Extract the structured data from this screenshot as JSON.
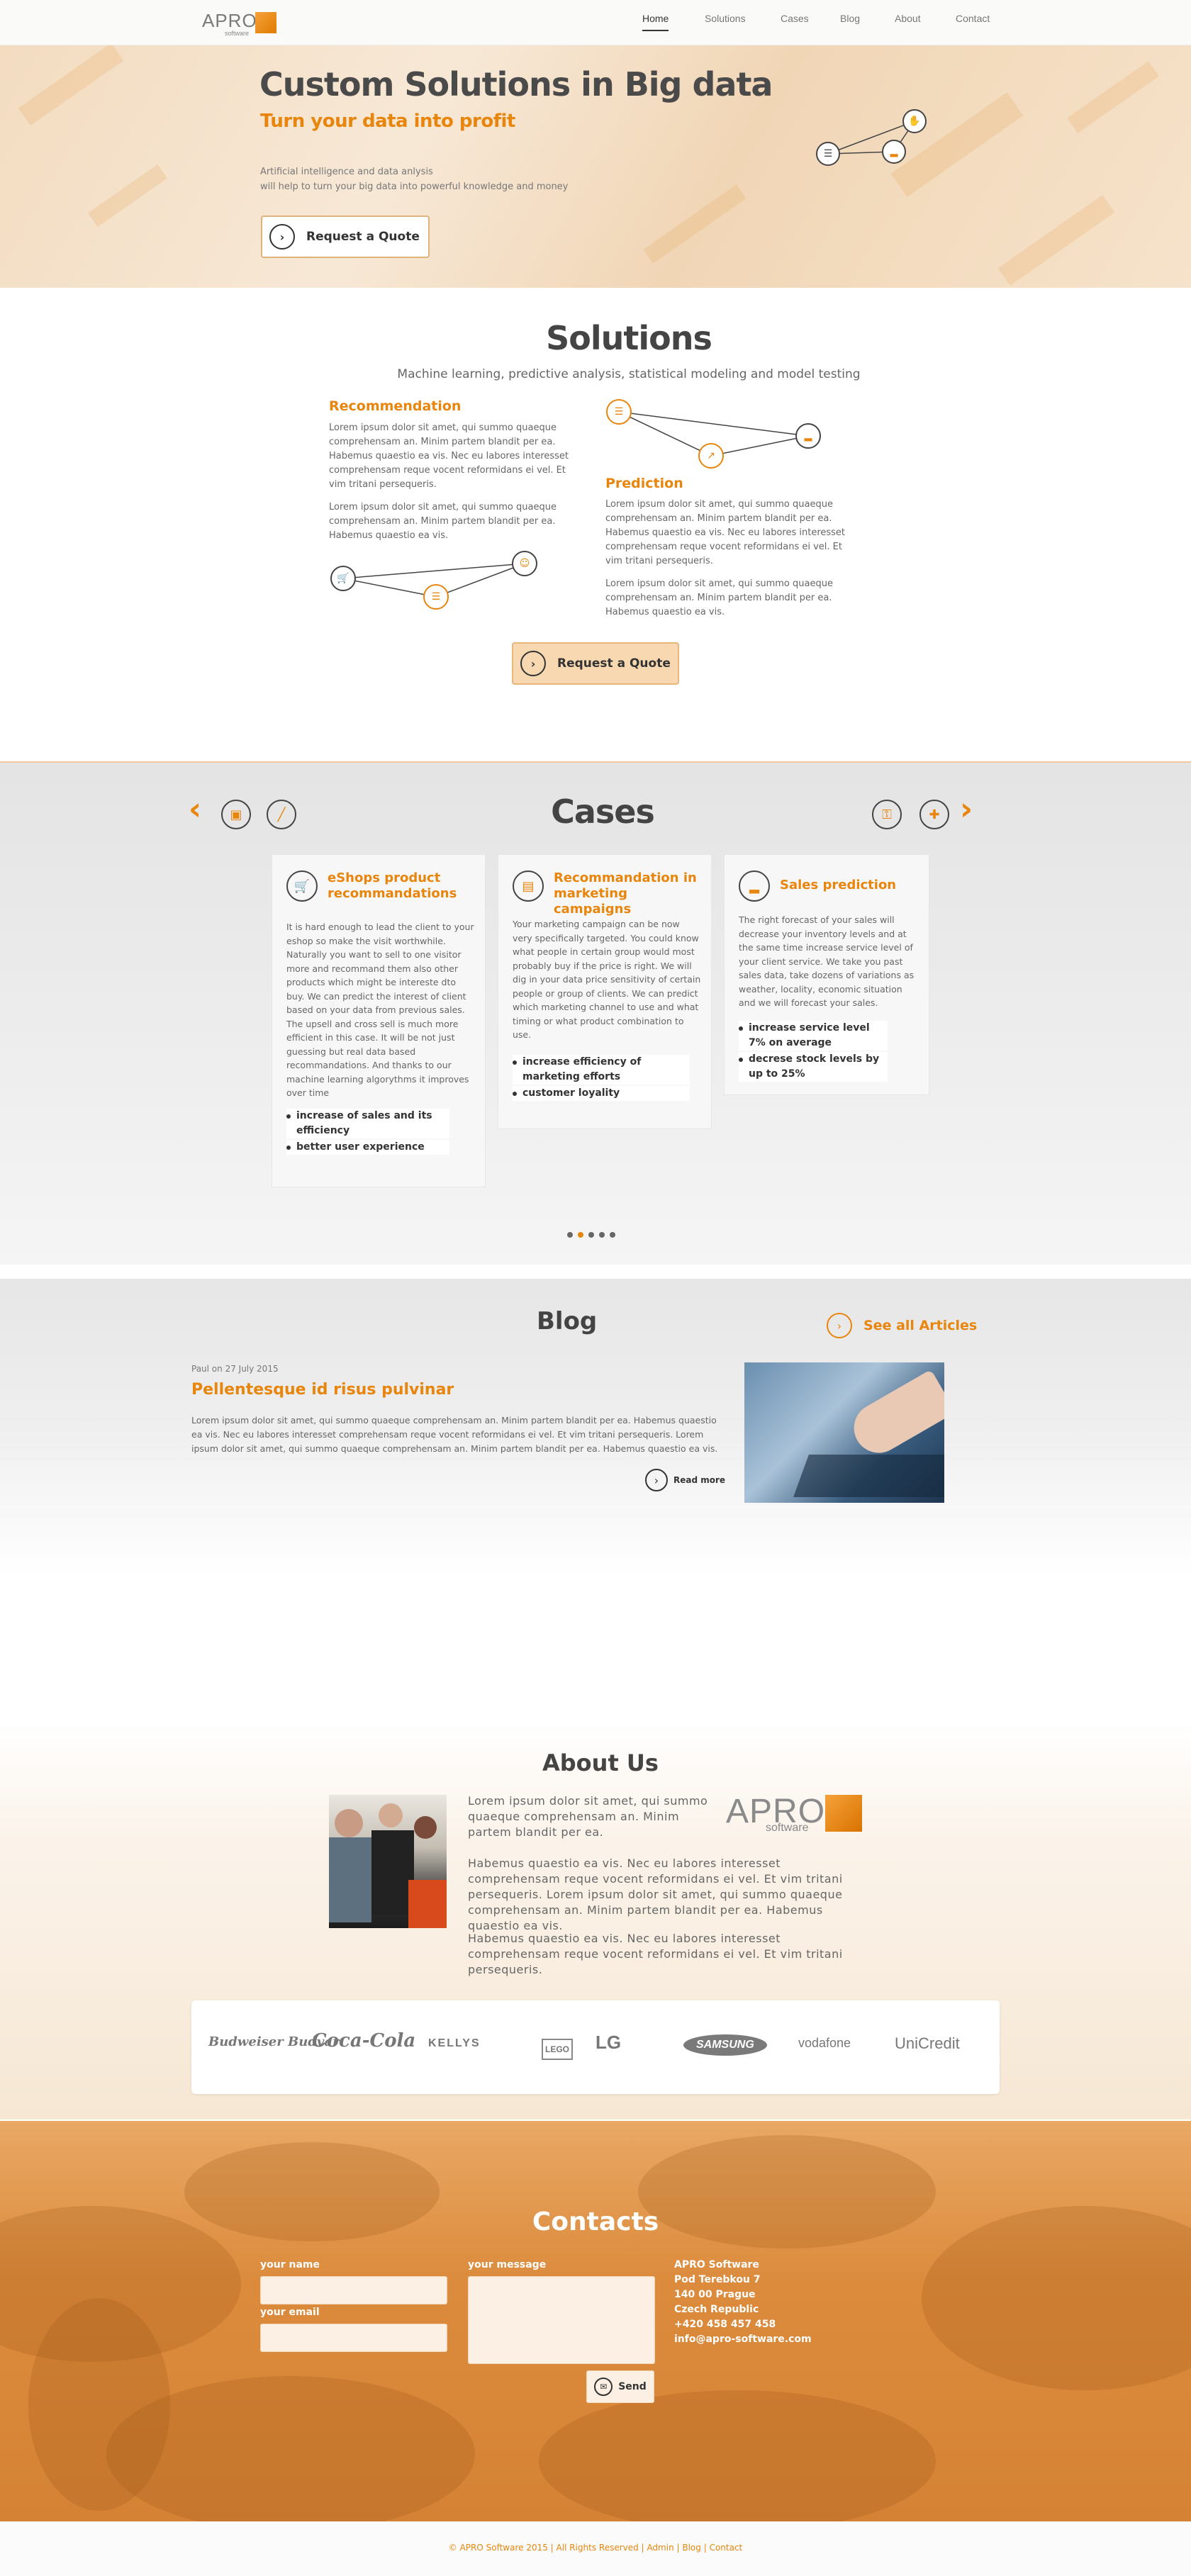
{
  "nav": {
    "logo": {
      "name": "APRO",
      "sub": "software"
    },
    "links": [
      "Home",
      "Solutions",
      "Cases",
      "Blog",
      "About",
      "Contact"
    ]
  },
  "hero": {
    "title": "Custom Solutions in Big data",
    "subtitle": "Turn your data into profit",
    "desc1": "Artificial intelligence and data anlysis",
    "desc2": "will help to turn your big data into powerful knowledge and money",
    "button": "Request a Quote"
  },
  "solutions": {
    "title": "Solutions",
    "subtitle": "Machine learning, predictive analysis, statistical modeling and model testing",
    "rec_title": "Recommendation",
    "rec_p1": "Lorem ipsum dolor sit amet, qui summo quaeque comprehensam an. Minim partem blandit per ea. Habemus quaestio ea vis. Nec eu labores interesset comprehensam reque vocent reformidans ei vel. Et vim tritani persequeris.",
    "rec_p2": "Lorem ipsum dolor sit amet, qui summo quaeque comprehensam an. Minim partem blandit per ea. Habemus quaestio ea vis.",
    "pred_title": "Prediction",
    "pred_p1": "Lorem ipsum dolor sit amet, qui summo quaeque comprehensam an. Minim partem blandit per ea. Habemus quaestio ea vis. Nec eu labores interesset comprehensam reque vocent reformidans ei vel. Et vim tritani persequeris.",
    "pred_p2": "Lorem ipsum dolor sit amet, qui summo quaeque comprehensam an. Minim partem blandit per ea. Habemus quaestio ea vis.",
    "button": "Request a Quote"
  },
  "cases": {
    "title": "Cases",
    "cards": [
      {
        "title": "eShops product recommandations",
        "text": "It is hard enough to lead the client to your eshop so make the visit worthwhile. Naturally you want to sell to one visitor more and recommand them also other products which might be intereste dto buy. We can predict the interest of client based on your data from previous sales. The upsell and cross sell is much more efficient in this case. It will be not just guessing but real data based recommandations. And thanks to our machine learning algorythms it improves over time",
        "bullets": [
          "increase of sales and its efficiency",
          "better user experience"
        ]
      },
      {
        "title": "Recommandation in marketing campaigns",
        "text": "Your marketing campaign can be now very specifically targeted. You could know what people in certain group would most probably buy if the price is right. We will dig in your data price sensitivity of certain people or group of clients. We can predict which marketing channel to use and what timing or what product combination to use.",
        "bullets": [
          "increase efficiency of marketing efforts",
          "customer loyality"
        ]
      },
      {
        "title": "Sales prediction",
        "text": "The right forecast of your sales will decrease your inventory levels and at the same time increase service level of your client service. We take you past sales data, take dozens of variations as weather, locality, economic situation and we will forecast your sales.",
        "bullets": [
          "increase service level 7% on average",
          "decrese stock levels by up to 25%"
        ]
      }
    ]
  },
  "blog": {
    "title": "Blog",
    "see_all": "See all Articles",
    "meta": "Paul on 27 July 2015",
    "post_title": "Pellentesque id risus pulvinar",
    "post_text": "Lorem ipsum dolor sit amet, qui summo quaeque comprehensam an. Minim partem blandit per ea. Habemus quaestio ea vis. Nec eu labores interesset comprehensam reque vocent reformidans ei vel. Et vim tritani persequeris. Lorem ipsum dolor sit amet, qui summo quaeque comprehensam an. Minim partem blandit per ea. Habemus quaestio ea vis.",
    "read_more": "Read more"
  },
  "about": {
    "title": "About Us",
    "p1": "Lorem ipsum dolor sit amet, qui summo quaeque comprehensam an. Minim partem blandit per ea.",
    "p2": "Habemus quaestio ea vis. Nec eu labores interesset comprehensam reque vocent reformidans ei vel. Et vim tritani persequeris. Lorem ipsum dolor sit amet, qui summo quaeque comprehensam an. Minim partem blandit per ea. Habemus quaestio ea vis.",
    "p3": "Habemus quaestio ea vis. Nec eu labores interesset comprehensam reque vocent reformidans ei vel. Et vim tritani persequeris.",
    "logo_name": "APRO",
    "logo_sub": "software",
    "clients": [
      "Budweiser Budvar",
      "Coca-Cola",
      "KELLYS",
      "LEGO",
      "LG",
      "SAMSUNG",
      "vodafone",
      "UniCredit"
    ]
  },
  "contacts": {
    "title": "Contacts",
    "name_label": "your name",
    "email_label": "your email",
    "message_label": "your message",
    "send": "Send",
    "info": [
      "APRO Software",
      "Pod Terebkou 7",
      "140 00 Prague",
      "Czech Republic",
      "+420 458 457 458",
      "info@apro-software.com"
    ]
  },
  "footer": {
    "copyright": "© APRO Software 2015 | All Rights Reserved |",
    "links": [
      "Admin",
      "Blog",
      "Contact"
    ]
  },
  "colors": {
    "accent": "#e8850c",
    "dark": "#444444"
  }
}
